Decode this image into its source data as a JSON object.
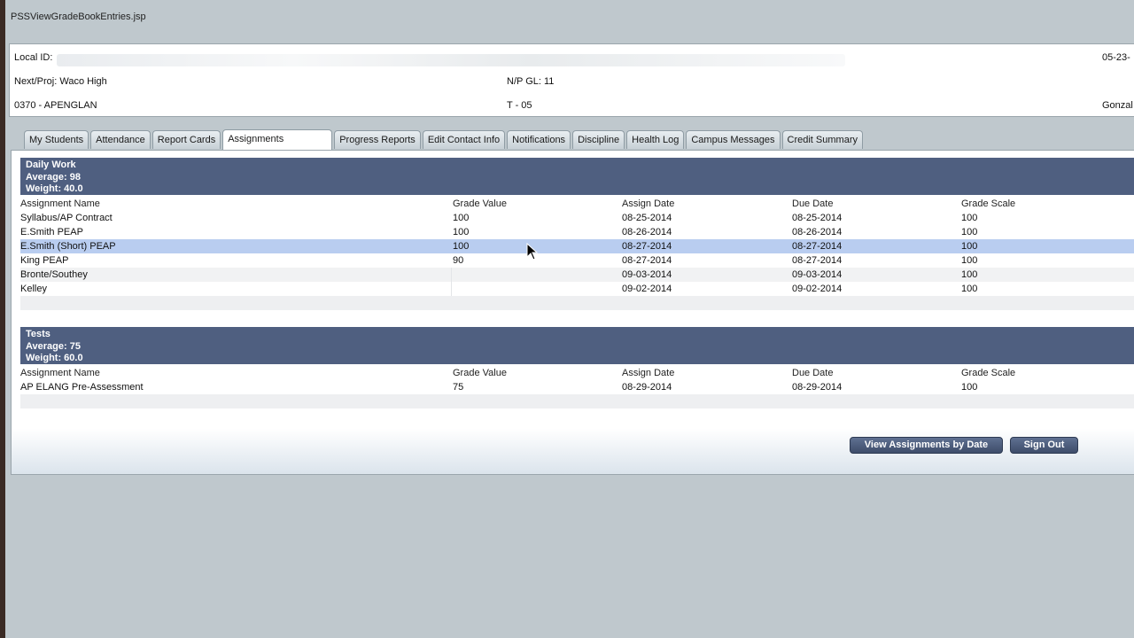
{
  "window": {
    "title": "PSSViewGradeBookEntries.jsp"
  },
  "student_info": {
    "local_id_label": "Local ID:",
    "date_partial": "05-23-",
    "next_proj": "Next/Proj: Waco High",
    "np_gl": "N/P GL: 11",
    "course": "0370 - APENGLAN",
    "term": "T - 05",
    "teacher_partial": "Gonzal"
  },
  "tabs": [
    {
      "label": "My Students"
    },
    {
      "label": "Attendance"
    },
    {
      "label": "Report Cards"
    },
    {
      "label": "Assignments"
    },
    {
      "label": "Progress Reports"
    },
    {
      "label": "Edit Contact Info"
    },
    {
      "label": "Notifications"
    },
    {
      "label": "Discipline"
    },
    {
      "label": "Health Log"
    },
    {
      "label": "Campus Messages"
    },
    {
      "label": "Credit Summary"
    }
  ],
  "active_tab": "Assignments",
  "columns": [
    "Assignment Name",
    "Grade Value",
    "Assign Date",
    "Due Date",
    "Grade Scale"
  ],
  "daily_work": {
    "title": "Daily Work",
    "average": "Average: 98",
    "weight": "Weight: 40.0",
    "rows": [
      {
        "name": "Syllabus/AP Contract",
        "grade": "100",
        "assign": "08-25-2014",
        "due": "08-25-2014",
        "scale": "100"
      },
      {
        "name": "E.Smith PEAP",
        "grade": "100",
        "assign": "08-26-2014",
        "due": "08-26-2014",
        "scale": "100"
      },
      {
        "name": "E.Smith (Short) PEAP",
        "grade": "100",
        "assign": "08-27-2014",
        "due": "08-27-2014",
        "scale": "100"
      },
      {
        "name": "King PEAP",
        "grade": "90",
        "assign": "08-27-2014",
        "due": "08-27-2014",
        "scale": "100"
      },
      {
        "name": "Bronte/Southey",
        "grade": "",
        "assign": "09-03-2014",
        "due": "09-03-2014",
        "scale": "100"
      },
      {
        "name": "Kelley",
        "grade": "",
        "assign": "09-02-2014",
        "due": "09-02-2014",
        "scale": "100"
      }
    ]
  },
  "tests": {
    "title": "Tests",
    "average": "Average: 75",
    "weight": "Weight: 60.0",
    "rows": [
      {
        "name": "AP ELANG Pre-Assessment",
        "grade": "75",
        "assign": "08-29-2014",
        "due": "08-29-2014",
        "scale": "100"
      }
    ]
  },
  "buttons": {
    "view_by_date": "View Assignments by Date",
    "sign_out": "Sign Out"
  },
  "colors": {
    "section_header": "#4f5f80",
    "selected_row": "#b9cdf0",
    "background": "#bfc8cd"
  }
}
